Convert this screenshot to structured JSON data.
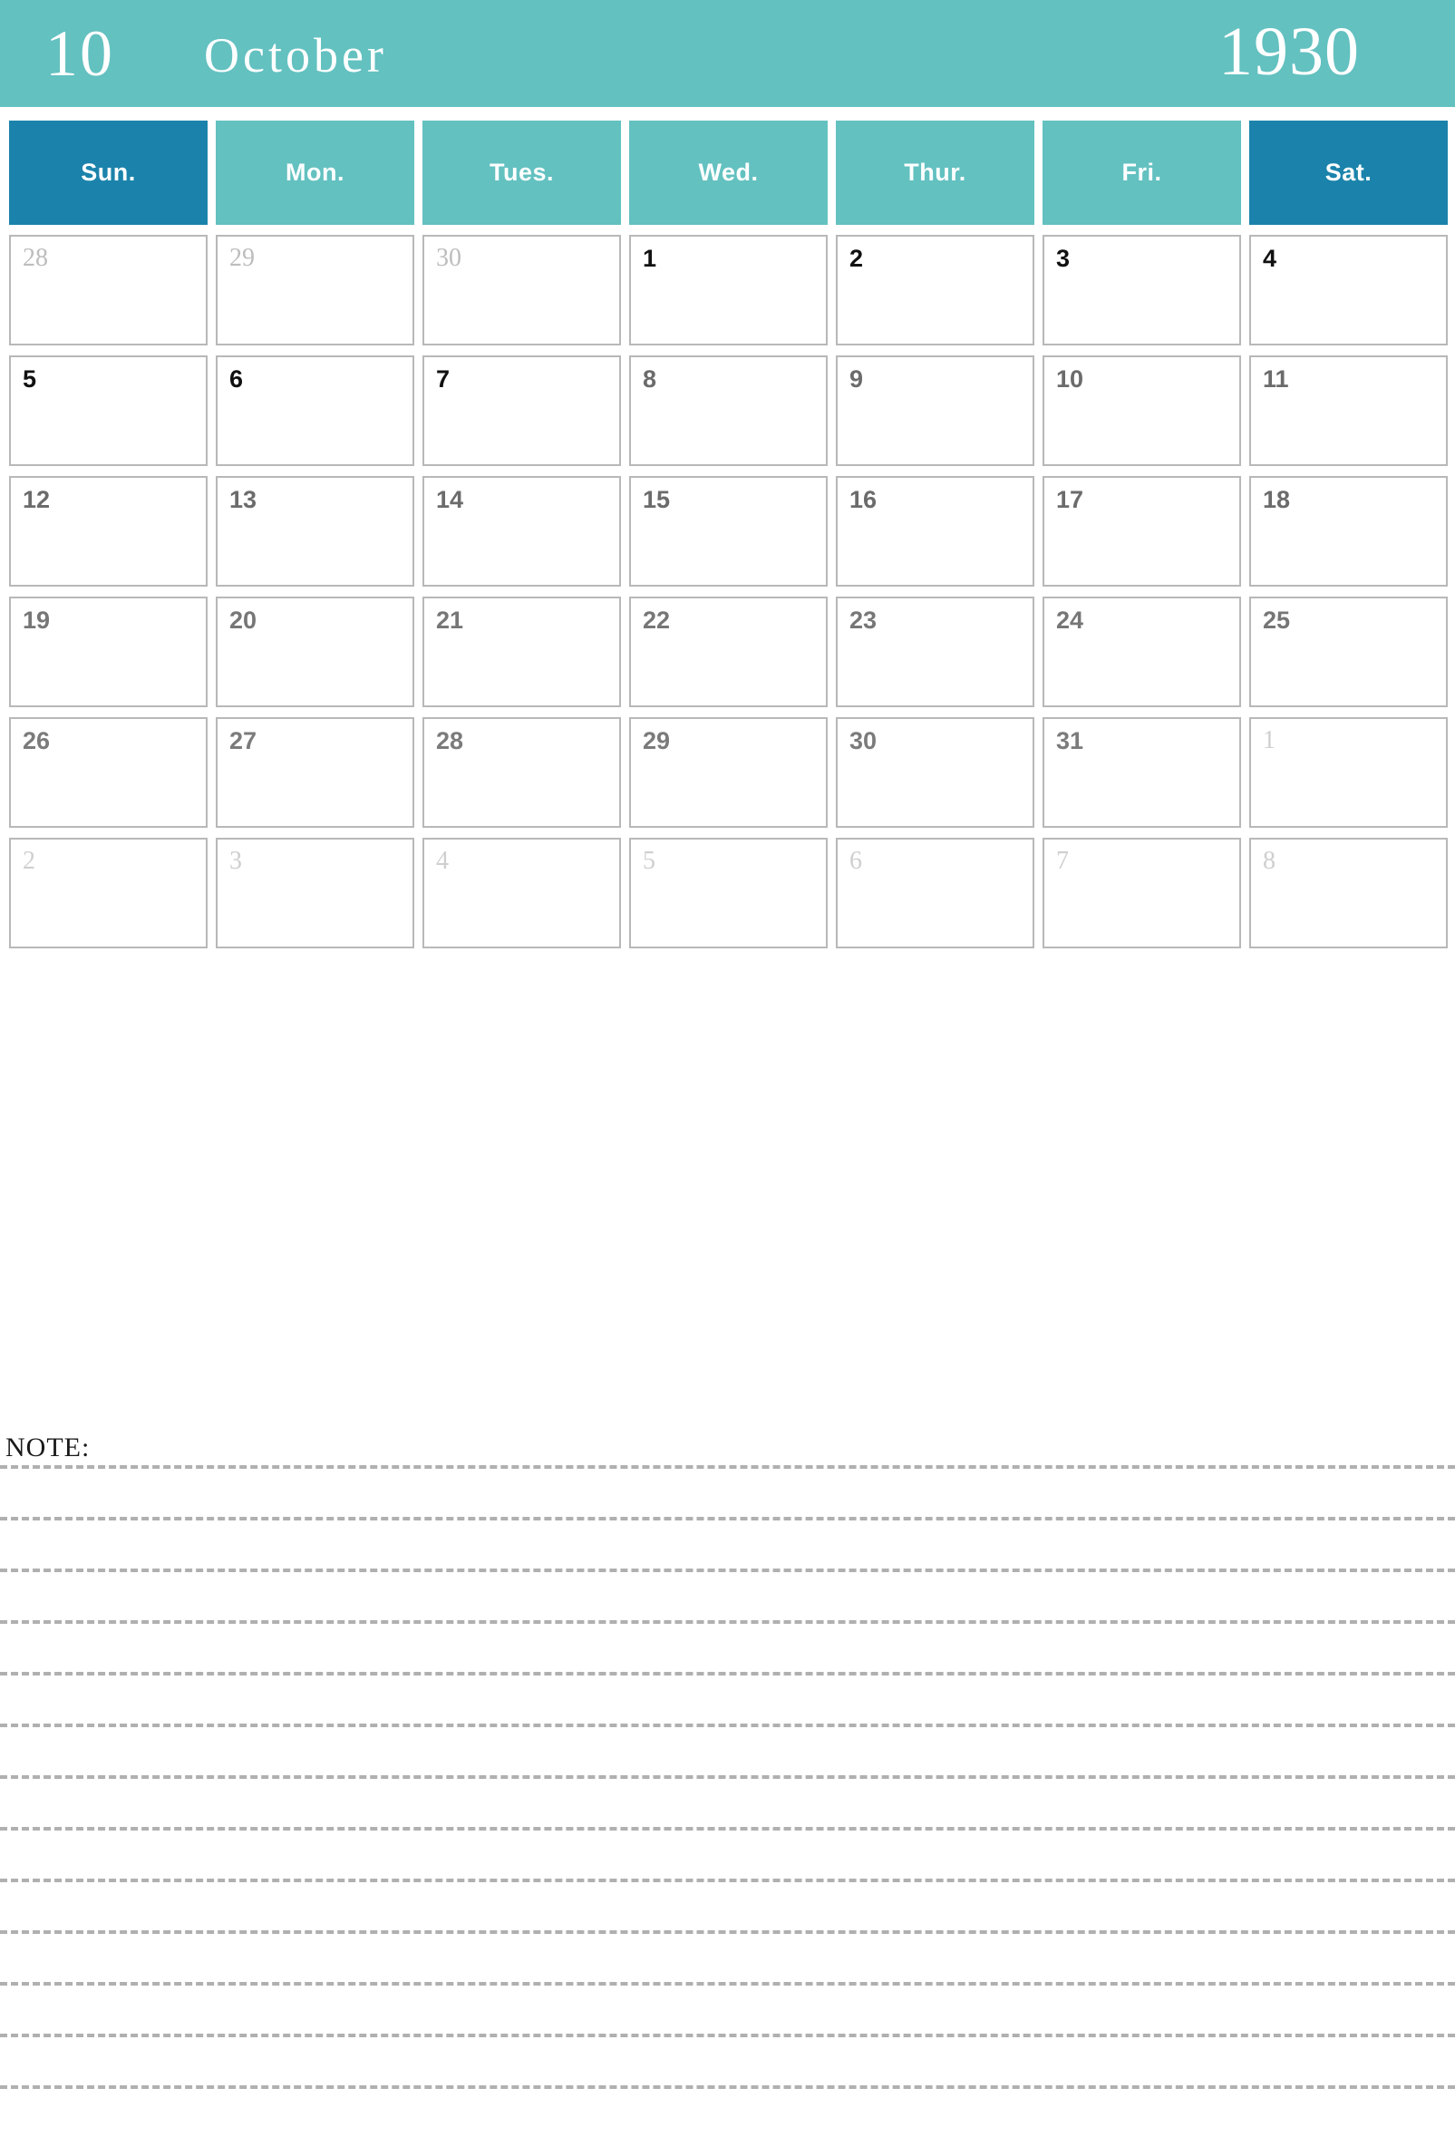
{
  "header": {
    "month_number": "10",
    "month_name": "October",
    "year": "1930",
    "background_color": "#63c1c0",
    "text_color": "#ffffff"
  },
  "weekdays": [
    {
      "label": "Sun.",
      "weekend": true,
      "color": "#1b83ab"
    },
    {
      "label": "Mon.",
      "weekend": false,
      "color": "#63c1c0"
    },
    {
      "label": "Tues.",
      "weekend": false,
      "color": "#63c1c0"
    },
    {
      "label": "Wed.",
      "weekend": false,
      "color": "#63c1c0"
    },
    {
      "label": "Thur.",
      "weekend": false,
      "color": "#63c1c0"
    },
    {
      "label": "Fri.",
      "weekend": false,
      "color": "#63c1c0"
    },
    {
      "label": "Sat.",
      "weekend": true,
      "color": "#1b83ab"
    }
  ],
  "weeks": [
    {
      "days": [
        {
          "num": "28",
          "in_month": false
        },
        {
          "num": "29",
          "in_month": false
        },
        {
          "num": "30",
          "in_month": false
        },
        {
          "num": "1",
          "in_month": true
        },
        {
          "num": "2",
          "in_month": true
        },
        {
          "num": "3",
          "in_month": true
        },
        {
          "num": "4",
          "in_month": true
        }
      ]
    },
    {
      "days": [
        {
          "num": "5",
          "in_month": true
        },
        {
          "num": "6",
          "in_month": true
        },
        {
          "num": "7",
          "in_month": true
        },
        {
          "num": "8",
          "in_month": true
        },
        {
          "num": "9",
          "in_month": true
        },
        {
          "num": "10",
          "in_month": true
        },
        {
          "num": "11",
          "in_month": true
        }
      ]
    },
    {
      "days": [
        {
          "num": "12",
          "in_month": true
        },
        {
          "num": "13",
          "in_month": true
        },
        {
          "num": "14",
          "in_month": true
        },
        {
          "num": "15",
          "in_month": true
        },
        {
          "num": "16",
          "in_month": true
        },
        {
          "num": "17",
          "in_month": true
        },
        {
          "num": "18",
          "in_month": true
        }
      ]
    },
    {
      "days": [
        {
          "num": "19",
          "in_month": true
        },
        {
          "num": "20",
          "in_month": true
        },
        {
          "num": "21",
          "in_month": true
        },
        {
          "num": "22",
          "in_month": true
        },
        {
          "num": "23",
          "in_month": true
        },
        {
          "num": "24",
          "in_month": true
        },
        {
          "num": "25",
          "in_month": true
        }
      ]
    },
    {
      "days": [
        {
          "num": "26",
          "in_month": true
        },
        {
          "num": "27",
          "in_month": true
        },
        {
          "num": "28",
          "in_month": true
        },
        {
          "num": "29",
          "in_month": true
        },
        {
          "num": "30",
          "in_month": true
        },
        {
          "num": "31",
          "in_month": true
        },
        {
          "num": "1",
          "in_month": false
        }
      ]
    },
    {
      "days": [
        {
          "num": "2",
          "in_month": false
        },
        {
          "num": "3",
          "in_month": false
        },
        {
          "num": "4",
          "in_month": false
        },
        {
          "num": "5",
          "in_month": false
        },
        {
          "num": "6",
          "in_month": false
        },
        {
          "num": "7",
          "in_month": false
        },
        {
          "num": "8",
          "in_month": false
        }
      ]
    }
  ],
  "note": {
    "label": "NOTE:",
    "line_count": 13,
    "line_color": "#b0b0b0"
  },
  "colors": {
    "banner": "#63c1c0",
    "weekend_header": "#1b83ab",
    "weekday_header": "#63c1c0",
    "cell_border": "#b8b8b8",
    "in_month_text": "#111111",
    "out_month_text": "#bdbdbd"
  }
}
